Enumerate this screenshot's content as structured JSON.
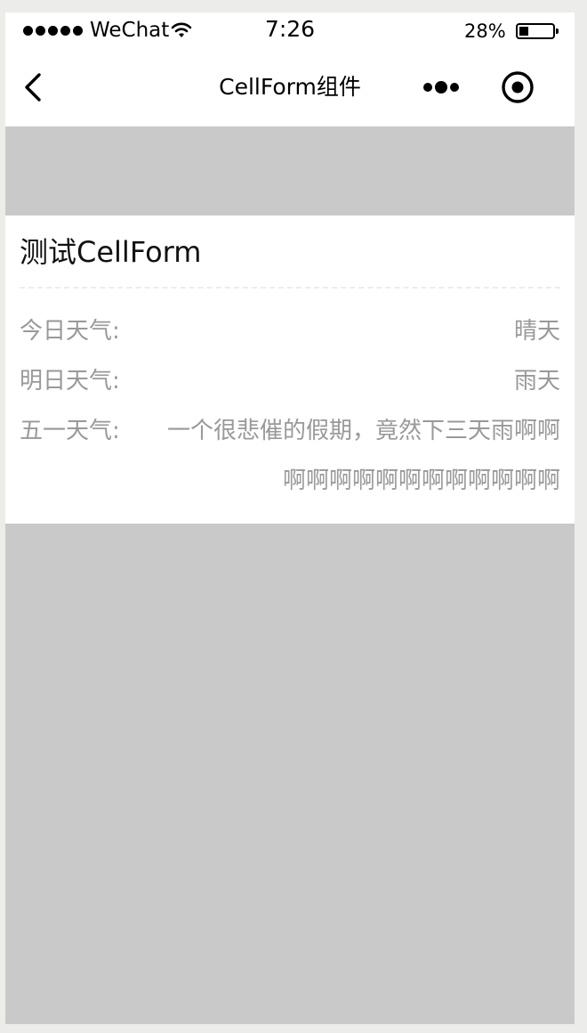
{
  "status_bar": {
    "carrier": "WeChat",
    "time": "7:26",
    "battery_percent": "28%",
    "battery_level": 0.28
  },
  "nav": {
    "title": "CellForm组件"
  },
  "card": {
    "title": "测试CellForm",
    "rows": [
      {
        "label": "今日天气:",
        "value": "晴天"
      },
      {
        "label": "明日天气:",
        "value": "雨天"
      },
      {
        "label": "五一天气:",
        "value": "一个很悲催的假期，竟然下三天雨啊啊啊啊啊啊啊啊啊啊啊啊啊啊"
      }
    ]
  }
}
